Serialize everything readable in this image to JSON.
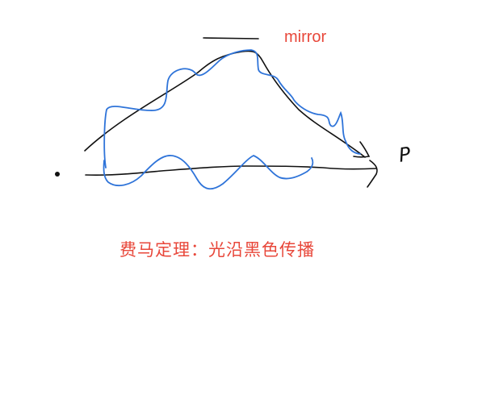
{
  "labels": {
    "mirror": "mirror",
    "point": "P",
    "caption": "费马定理：光沿黑色传播"
  },
  "colors": {
    "ink": "#111111",
    "blue_path": "#2f74d9",
    "annotation": "#e8473a",
    "background": "#ffffff"
  }
}
